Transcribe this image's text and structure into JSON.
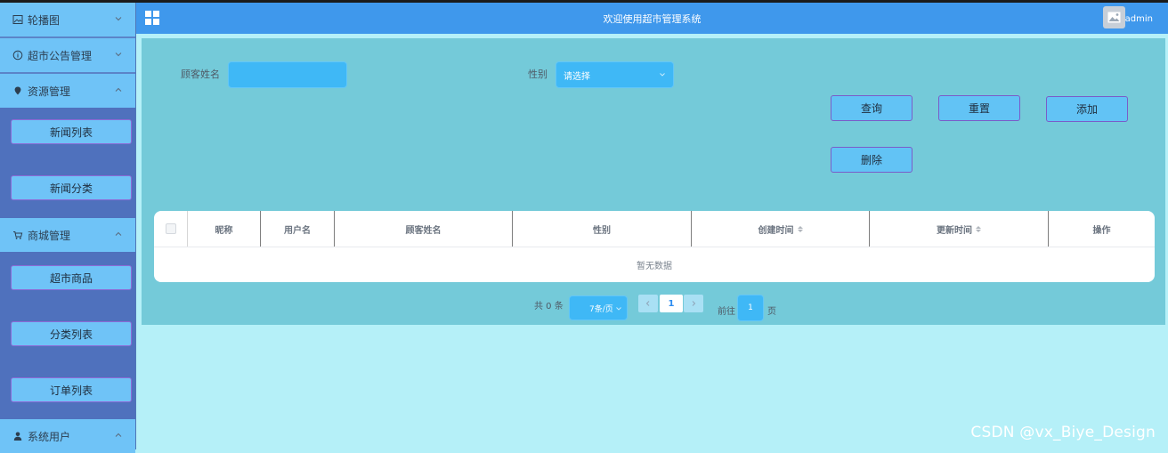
{
  "header": {
    "title": "欢迎使用超市管理系统",
    "user": "admin"
  },
  "sidebar": {
    "menus": [
      {
        "label": "轮播图",
        "icon": "picture-icon",
        "expanded": false
      },
      {
        "label": "超市公告管理",
        "icon": "info-icon",
        "expanded": false
      },
      {
        "label": "资源管理",
        "icon": "location-icon",
        "expanded": true,
        "items": [
          "新闻列表",
          "新闻分类"
        ]
      },
      {
        "label": "商城管理",
        "icon": "cart-icon",
        "expanded": true,
        "items": [
          "超市商品",
          "分类列表",
          "订单列表"
        ]
      },
      {
        "label": "系统用户",
        "icon": "user-icon",
        "expanded": true
      }
    ]
  },
  "search": {
    "customer_name_label": "顾客姓名",
    "customer_name_value": "",
    "gender_label": "性别",
    "gender_placeholder": "请选择"
  },
  "buttons": {
    "query": "查询",
    "reset": "重置",
    "add": "添加",
    "delete": "删除"
  },
  "table": {
    "columns": [
      "昵称",
      "用户名",
      "顾客姓名",
      "性别",
      "创建时间",
      "更新时间",
      "操作"
    ],
    "empty_text": "暂无数据"
  },
  "pagination": {
    "total": "共 0 条",
    "page_size": "7条/页",
    "current_page": "1",
    "goto_prefix": "前往",
    "goto_value": "1",
    "goto_suffix": "页"
  },
  "watermark": "CSDN @vx_Biye_Design",
  "colors": {
    "header": "#3f98ec",
    "panel": "#74cad9",
    "background": "#b5f0f8",
    "sidebar_head": "#6fc3f7",
    "sidebar_sub": "#4f71bd",
    "input": "#3fb8f6"
  }
}
